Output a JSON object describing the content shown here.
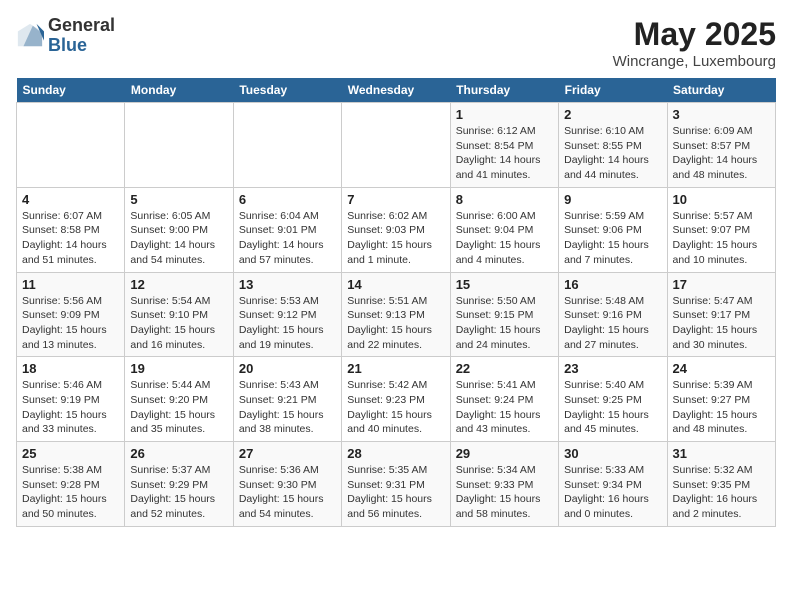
{
  "logo": {
    "general": "General",
    "blue": "Blue"
  },
  "title": "May 2025",
  "location": "Wincrange, Luxembourg",
  "days_of_week": [
    "Sunday",
    "Monday",
    "Tuesday",
    "Wednesday",
    "Thursday",
    "Friday",
    "Saturday"
  ],
  "weeks": [
    [
      {
        "day": "",
        "info": ""
      },
      {
        "day": "",
        "info": ""
      },
      {
        "day": "",
        "info": ""
      },
      {
        "day": "",
        "info": ""
      },
      {
        "day": "1",
        "info": "Sunrise: 6:12 AM\nSunset: 8:54 PM\nDaylight: 14 hours and 41 minutes."
      },
      {
        "day": "2",
        "info": "Sunrise: 6:10 AM\nSunset: 8:55 PM\nDaylight: 14 hours and 44 minutes."
      },
      {
        "day": "3",
        "info": "Sunrise: 6:09 AM\nSunset: 8:57 PM\nDaylight: 14 hours and 48 minutes."
      }
    ],
    [
      {
        "day": "4",
        "info": "Sunrise: 6:07 AM\nSunset: 8:58 PM\nDaylight: 14 hours and 51 minutes."
      },
      {
        "day": "5",
        "info": "Sunrise: 6:05 AM\nSunset: 9:00 PM\nDaylight: 14 hours and 54 minutes."
      },
      {
        "day": "6",
        "info": "Sunrise: 6:04 AM\nSunset: 9:01 PM\nDaylight: 14 hours and 57 minutes."
      },
      {
        "day": "7",
        "info": "Sunrise: 6:02 AM\nSunset: 9:03 PM\nDaylight: 15 hours and 1 minute."
      },
      {
        "day": "8",
        "info": "Sunrise: 6:00 AM\nSunset: 9:04 PM\nDaylight: 15 hours and 4 minutes."
      },
      {
        "day": "9",
        "info": "Sunrise: 5:59 AM\nSunset: 9:06 PM\nDaylight: 15 hours and 7 minutes."
      },
      {
        "day": "10",
        "info": "Sunrise: 5:57 AM\nSunset: 9:07 PM\nDaylight: 15 hours and 10 minutes."
      }
    ],
    [
      {
        "day": "11",
        "info": "Sunrise: 5:56 AM\nSunset: 9:09 PM\nDaylight: 15 hours and 13 minutes."
      },
      {
        "day": "12",
        "info": "Sunrise: 5:54 AM\nSunset: 9:10 PM\nDaylight: 15 hours and 16 minutes."
      },
      {
        "day": "13",
        "info": "Sunrise: 5:53 AM\nSunset: 9:12 PM\nDaylight: 15 hours and 19 minutes."
      },
      {
        "day": "14",
        "info": "Sunrise: 5:51 AM\nSunset: 9:13 PM\nDaylight: 15 hours and 22 minutes."
      },
      {
        "day": "15",
        "info": "Sunrise: 5:50 AM\nSunset: 9:15 PM\nDaylight: 15 hours and 24 minutes."
      },
      {
        "day": "16",
        "info": "Sunrise: 5:48 AM\nSunset: 9:16 PM\nDaylight: 15 hours and 27 minutes."
      },
      {
        "day": "17",
        "info": "Sunrise: 5:47 AM\nSunset: 9:17 PM\nDaylight: 15 hours and 30 minutes."
      }
    ],
    [
      {
        "day": "18",
        "info": "Sunrise: 5:46 AM\nSunset: 9:19 PM\nDaylight: 15 hours and 33 minutes."
      },
      {
        "day": "19",
        "info": "Sunrise: 5:44 AM\nSunset: 9:20 PM\nDaylight: 15 hours and 35 minutes."
      },
      {
        "day": "20",
        "info": "Sunrise: 5:43 AM\nSunset: 9:21 PM\nDaylight: 15 hours and 38 minutes."
      },
      {
        "day": "21",
        "info": "Sunrise: 5:42 AM\nSunset: 9:23 PM\nDaylight: 15 hours and 40 minutes."
      },
      {
        "day": "22",
        "info": "Sunrise: 5:41 AM\nSunset: 9:24 PM\nDaylight: 15 hours and 43 minutes."
      },
      {
        "day": "23",
        "info": "Sunrise: 5:40 AM\nSunset: 9:25 PM\nDaylight: 15 hours and 45 minutes."
      },
      {
        "day": "24",
        "info": "Sunrise: 5:39 AM\nSunset: 9:27 PM\nDaylight: 15 hours and 48 minutes."
      }
    ],
    [
      {
        "day": "25",
        "info": "Sunrise: 5:38 AM\nSunset: 9:28 PM\nDaylight: 15 hours and 50 minutes."
      },
      {
        "day": "26",
        "info": "Sunrise: 5:37 AM\nSunset: 9:29 PM\nDaylight: 15 hours and 52 minutes."
      },
      {
        "day": "27",
        "info": "Sunrise: 5:36 AM\nSunset: 9:30 PM\nDaylight: 15 hours and 54 minutes."
      },
      {
        "day": "28",
        "info": "Sunrise: 5:35 AM\nSunset: 9:31 PM\nDaylight: 15 hours and 56 minutes."
      },
      {
        "day": "29",
        "info": "Sunrise: 5:34 AM\nSunset: 9:33 PM\nDaylight: 15 hours and 58 minutes."
      },
      {
        "day": "30",
        "info": "Sunrise: 5:33 AM\nSunset: 9:34 PM\nDaylight: 16 hours and 0 minutes."
      },
      {
        "day": "31",
        "info": "Sunrise: 5:32 AM\nSunset: 9:35 PM\nDaylight: 16 hours and 2 minutes."
      }
    ]
  ]
}
